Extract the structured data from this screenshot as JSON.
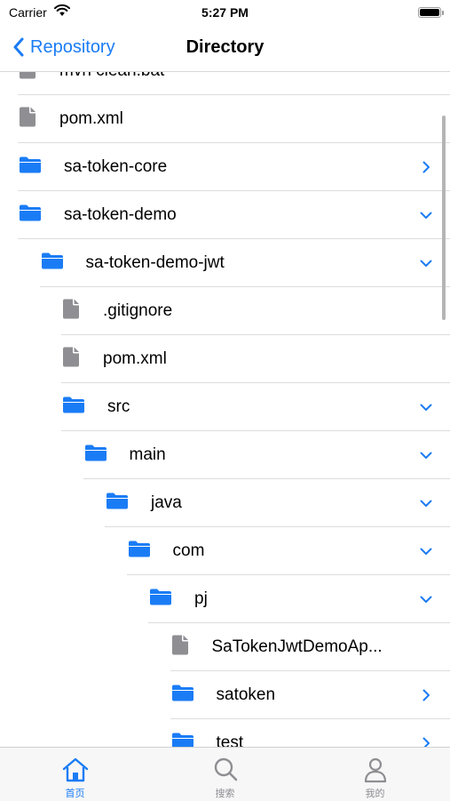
{
  "status_bar": {
    "carrier": "Carrier",
    "time": "5:27 PM"
  },
  "nav": {
    "back_label": "Repository",
    "title": "Directory"
  },
  "colors": {
    "accent": "#1a7cf5",
    "folder": "#1a7cf5",
    "file": "#8e8e93",
    "divider": "#dcdcdc",
    "inactive_tab": "#8e8e93"
  },
  "tree": [
    {
      "name": "mvn clean.bat",
      "type": "file",
      "depth": 0,
      "chevron": "none"
    },
    {
      "name": "pom.xml",
      "type": "file",
      "depth": 0,
      "chevron": "none"
    },
    {
      "name": "sa-token-core",
      "type": "folder",
      "depth": 0,
      "chevron": "right"
    },
    {
      "name": "sa-token-demo",
      "type": "folder",
      "depth": 0,
      "chevron": "down"
    },
    {
      "name": "sa-token-demo-jwt",
      "type": "folder",
      "depth": 1,
      "chevron": "down"
    },
    {
      "name": ".gitignore",
      "type": "file",
      "depth": 2,
      "chevron": "none"
    },
    {
      "name": "pom.xml",
      "type": "file",
      "depth": 2,
      "chevron": "none"
    },
    {
      "name": "src",
      "type": "folder",
      "depth": 2,
      "chevron": "down"
    },
    {
      "name": "main",
      "type": "folder",
      "depth": 3,
      "chevron": "down"
    },
    {
      "name": "java",
      "type": "folder",
      "depth": 4,
      "chevron": "down"
    },
    {
      "name": "com",
      "type": "folder",
      "depth": 5,
      "chevron": "down"
    },
    {
      "name": "pj",
      "type": "folder",
      "depth": 6,
      "chevron": "down"
    },
    {
      "name": "SaTokenJwtDemoAp...",
      "type": "file",
      "depth": 7,
      "chevron": "none"
    },
    {
      "name": "satoken",
      "type": "folder",
      "depth": 7,
      "chevron": "right"
    },
    {
      "name": "test",
      "type": "folder",
      "depth": 7,
      "chevron": "right"
    }
  ],
  "tabs": [
    {
      "label": "首页",
      "icon": "home-icon",
      "active": true
    },
    {
      "label": "搜索",
      "icon": "search-icon",
      "active": false
    },
    {
      "label": "我的",
      "icon": "person-icon",
      "active": false
    }
  ]
}
